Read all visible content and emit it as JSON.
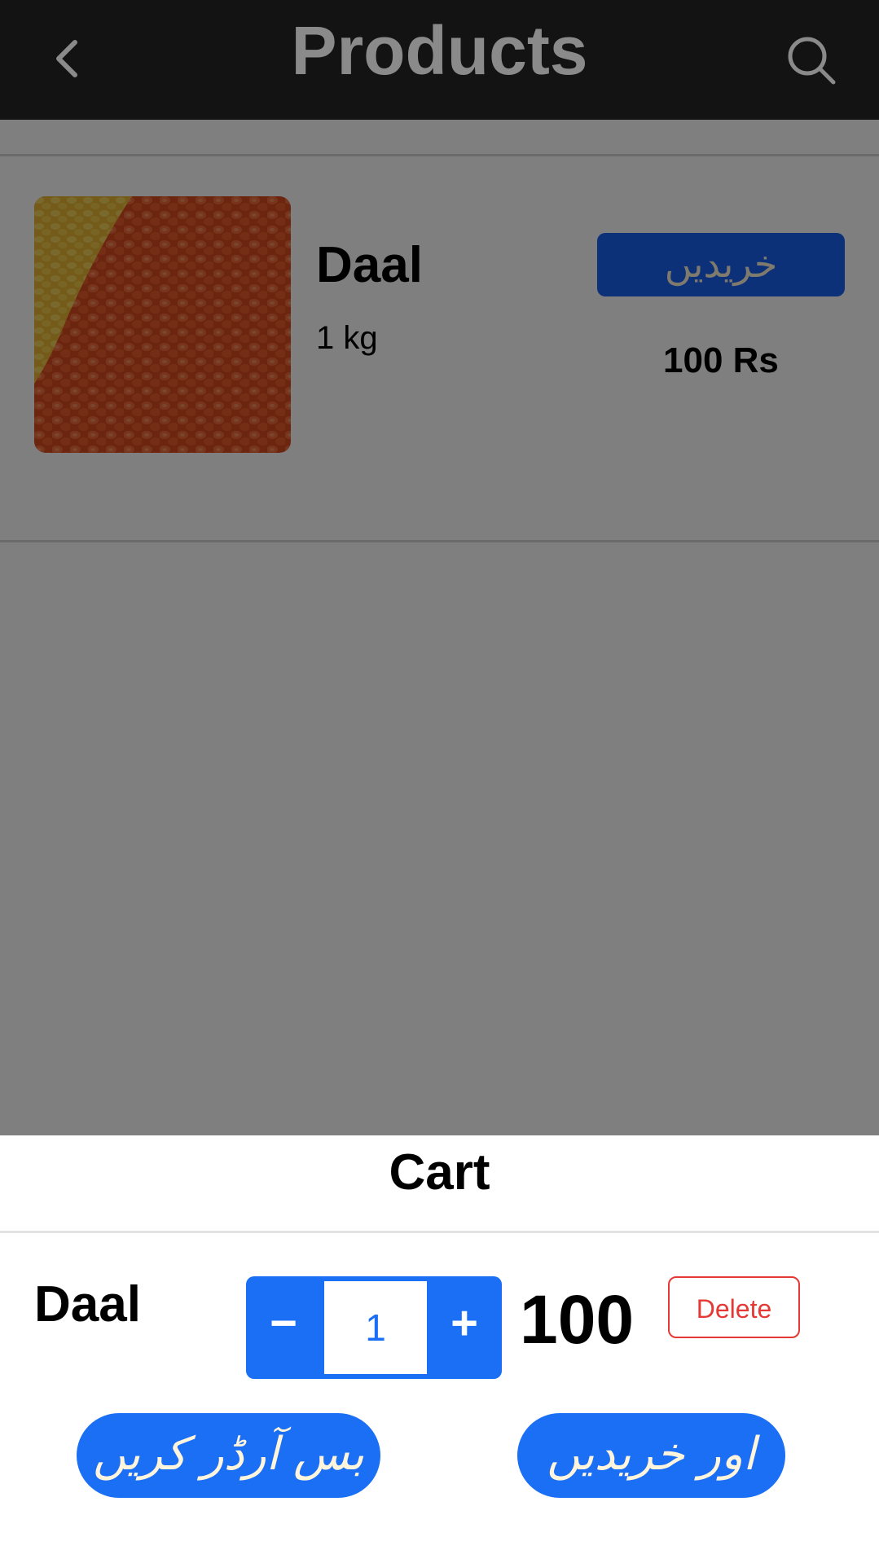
{
  "header": {
    "title": "Products",
    "back_icon": "chevron-left-icon",
    "search_icon": "search-icon"
  },
  "product": {
    "name": "Daal",
    "quantity": "1 kg",
    "buy_label": "خریدیں",
    "price": "100 Rs",
    "image_icon": "lentils-photo"
  },
  "cart": {
    "title": "Cart",
    "item": {
      "name": "Daal",
      "minus_label": "−",
      "quantity": "1",
      "plus_label": "+",
      "price": "100",
      "delete_label": "Delete"
    },
    "order_label": "بس آرڈر کریں",
    "buy_more_label": "اور خریدیں"
  },
  "colors": {
    "header_bg": "#131313",
    "accent": "#1a6ff5",
    "delete": "#e53935",
    "button_text": "#fff4dc"
  }
}
